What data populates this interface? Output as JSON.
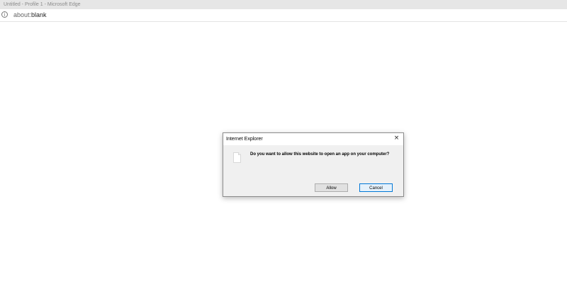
{
  "window": {
    "title": "Untitled - Profile 1 - Microsoft Edge"
  },
  "address_bar": {
    "icon": "info-icon",
    "url_scheme": "about:",
    "url_rest": "blank"
  },
  "dialog": {
    "title": "Internet Explorer",
    "close_glyph": "×",
    "message": "Do you want to allow this website to open an app on your computer?",
    "allow_label": "Allow",
    "cancel_label": "Cancel"
  },
  "colors": {
    "titlebar_bg": "#e6e6e6",
    "dialog_bg": "#f0f0f0",
    "default_button_border": "#0078d7"
  }
}
